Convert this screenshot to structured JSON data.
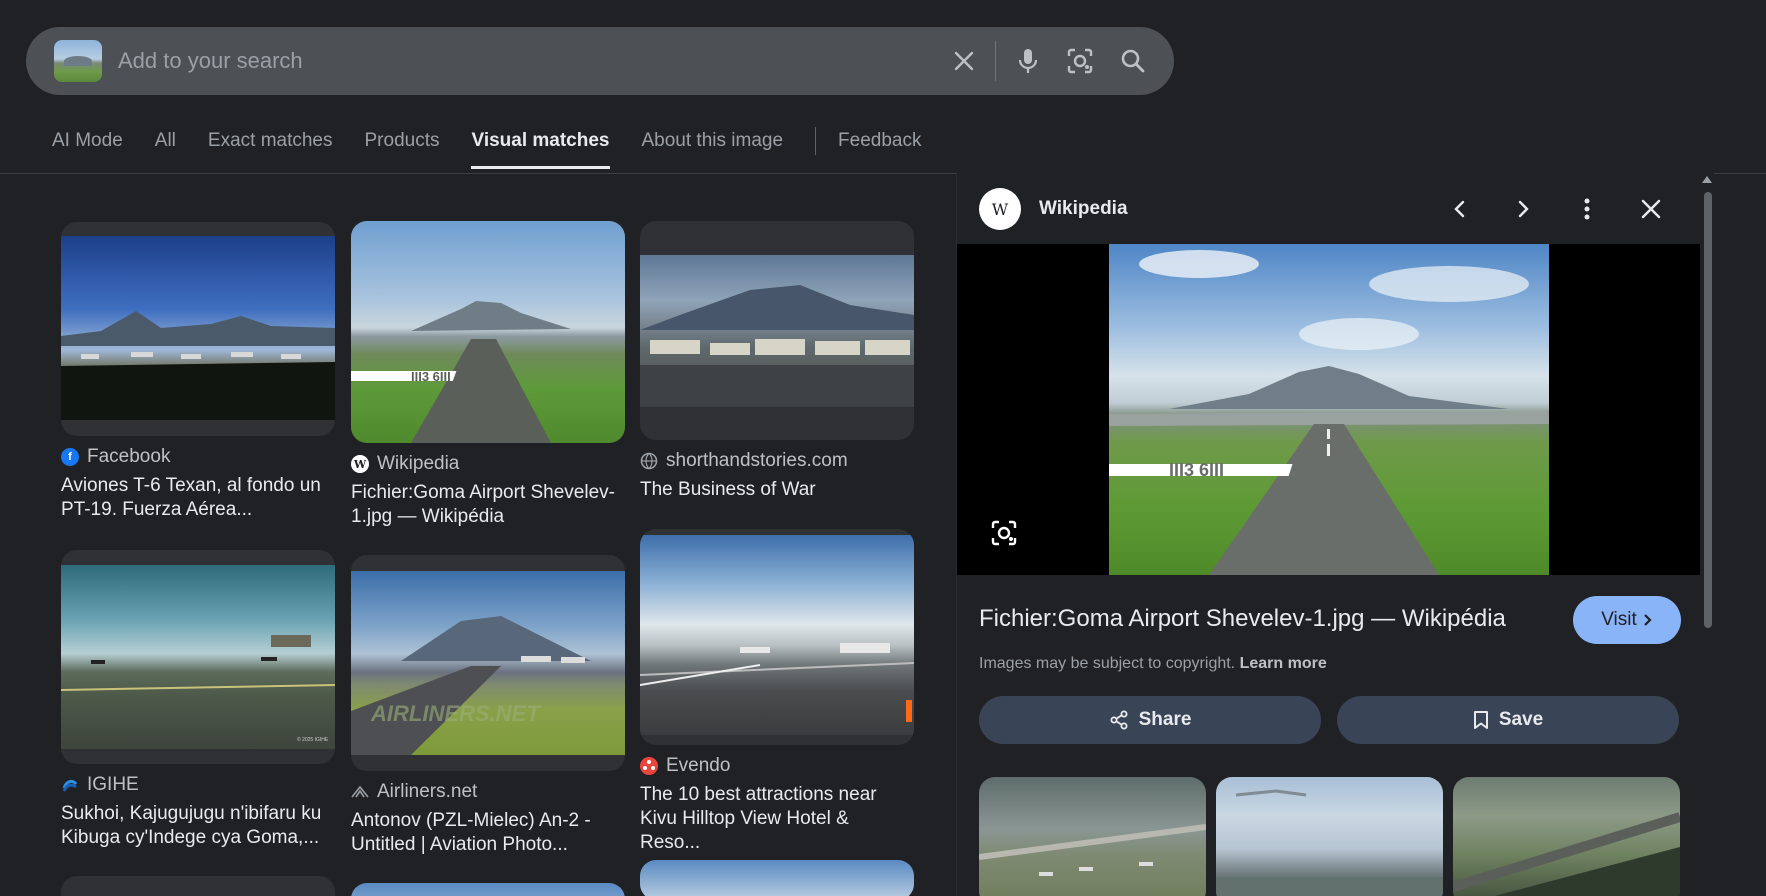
{
  "search": {
    "placeholder": "Add to your search",
    "value": "",
    "icons": [
      "clear-icon",
      "microphone-icon",
      "lens-icon",
      "search-icon"
    ]
  },
  "tabs": [
    {
      "label": "AI Mode",
      "active": false
    },
    {
      "label": "All",
      "active": false
    },
    {
      "label": "Exact matches",
      "active": false
    },
    {
      "label": "Products",
      "active": false
    },
    {
      "label": "Visual matches",
      "active": true
    },
    {
      "label": "About this image",
      "active": false
    },
    {
      "label": "Feedback",
      "active": false
    }
  ],
  "results": [
    {
      "source": "Facebook",
      "title": "Aviones T-6 Texan, al fondo un PT-19. Fuerza Aérea...",
      "icon": "facebook-icon"
    },
    {
      "source": "IGIHE",
      "title": "Sukhoi, Kajugujugu n'ibifaru ku Kibuga cy'Indege cya Goma,...",
      "icon": "igihe-icon"
    },
    {
      "source": "Wikipedia",
      "title": "Fichier:Goma Airport Shevelev-1.jpg — Wikipédia",
      "icon": "wikipedia-icon"
    },
    {
      "source": "Airliners.net",
      "title": "Antonov (PZL-Mielec) An-2 - Untitled | Aviation Photo...",
      "icon": "airliners-icon"
    },
    {
      "source": "shorthandstories.com",
      "title": "The Business of War",
      "icon": "globe-icon"
    },
    {
      "source": "Evendo",
      "title": "The 10 best attractions near Kivu Hilltop View Hotel & Reso...",
      "icon": "evendo-icon"
    }
  ],
  "watermarks": {
    "airliners": "AIRLINERS.NET",
    "igihe": "© 2025 IGIHE"
  },
  "panel": {
    "source": "Wikipedia",
    "logo_letter": "W",
    "title": "Fichier:Goma Airport Shevelev-1.jpg — Wikipédia",
    "visit_label": "Visit",
    "copyright_text": "Images may be subject to copyright.",
    "learn_more": "Learn more",
    "share_label": "Share",
    "save_label": "Save",
    "runway_marking": "III3 6III"
  },
  "colors": {
    "background": "#202124",
    "searchbar": "#4d5156",
    "visit_button": "#8ab4f8",
    "action_button": "#394457"
  }
}
